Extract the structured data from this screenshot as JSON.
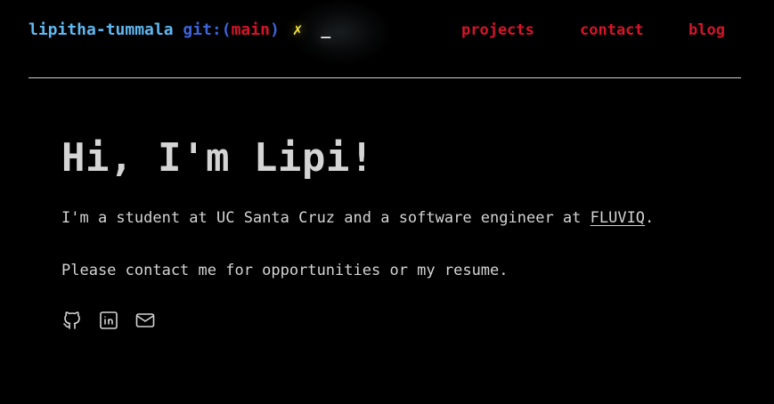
{
  "header": {
    "prompt_user": "lipitha-tummala",
    "prompt_git": "git:(",
    "prompt_branch": "main",
    "prompt_git_close": ")",
    "prompt_dirty": "✗",
    "prompt_cursor": "_",
    "nav": [
      {
        "label": "projects"
      },
      {
        "label": "contact"
      },
      {
        "label": "blog"
      }
    ]
  },
  "main": {
    "title": "Hi, I'm Lipi!",
    "intro_before": "I'm a student at UC Santa Cruz and a software engineer at ",
    "intro_link": "FLUVIQ",
    "intro_after": ".",
    "contact_line": "Please contact me for opportunities or my resume."
  },
  "socials": [
    {
      "icon": "github-icon"
    },
    {
      "icon": "linkedin-icon"
    },
    {
      "icon": "mail-icon"
    }
  ],
  "colors": {
    "background": "#000000",
    "text": "#d4d4d4",
    "prompt_user": "#5fb8f2",
    "prompt_git": "#3d63d9",
    "accent_red": "#d6142a",
    "dirty_yellow": "#f5e63a"
  }
}
